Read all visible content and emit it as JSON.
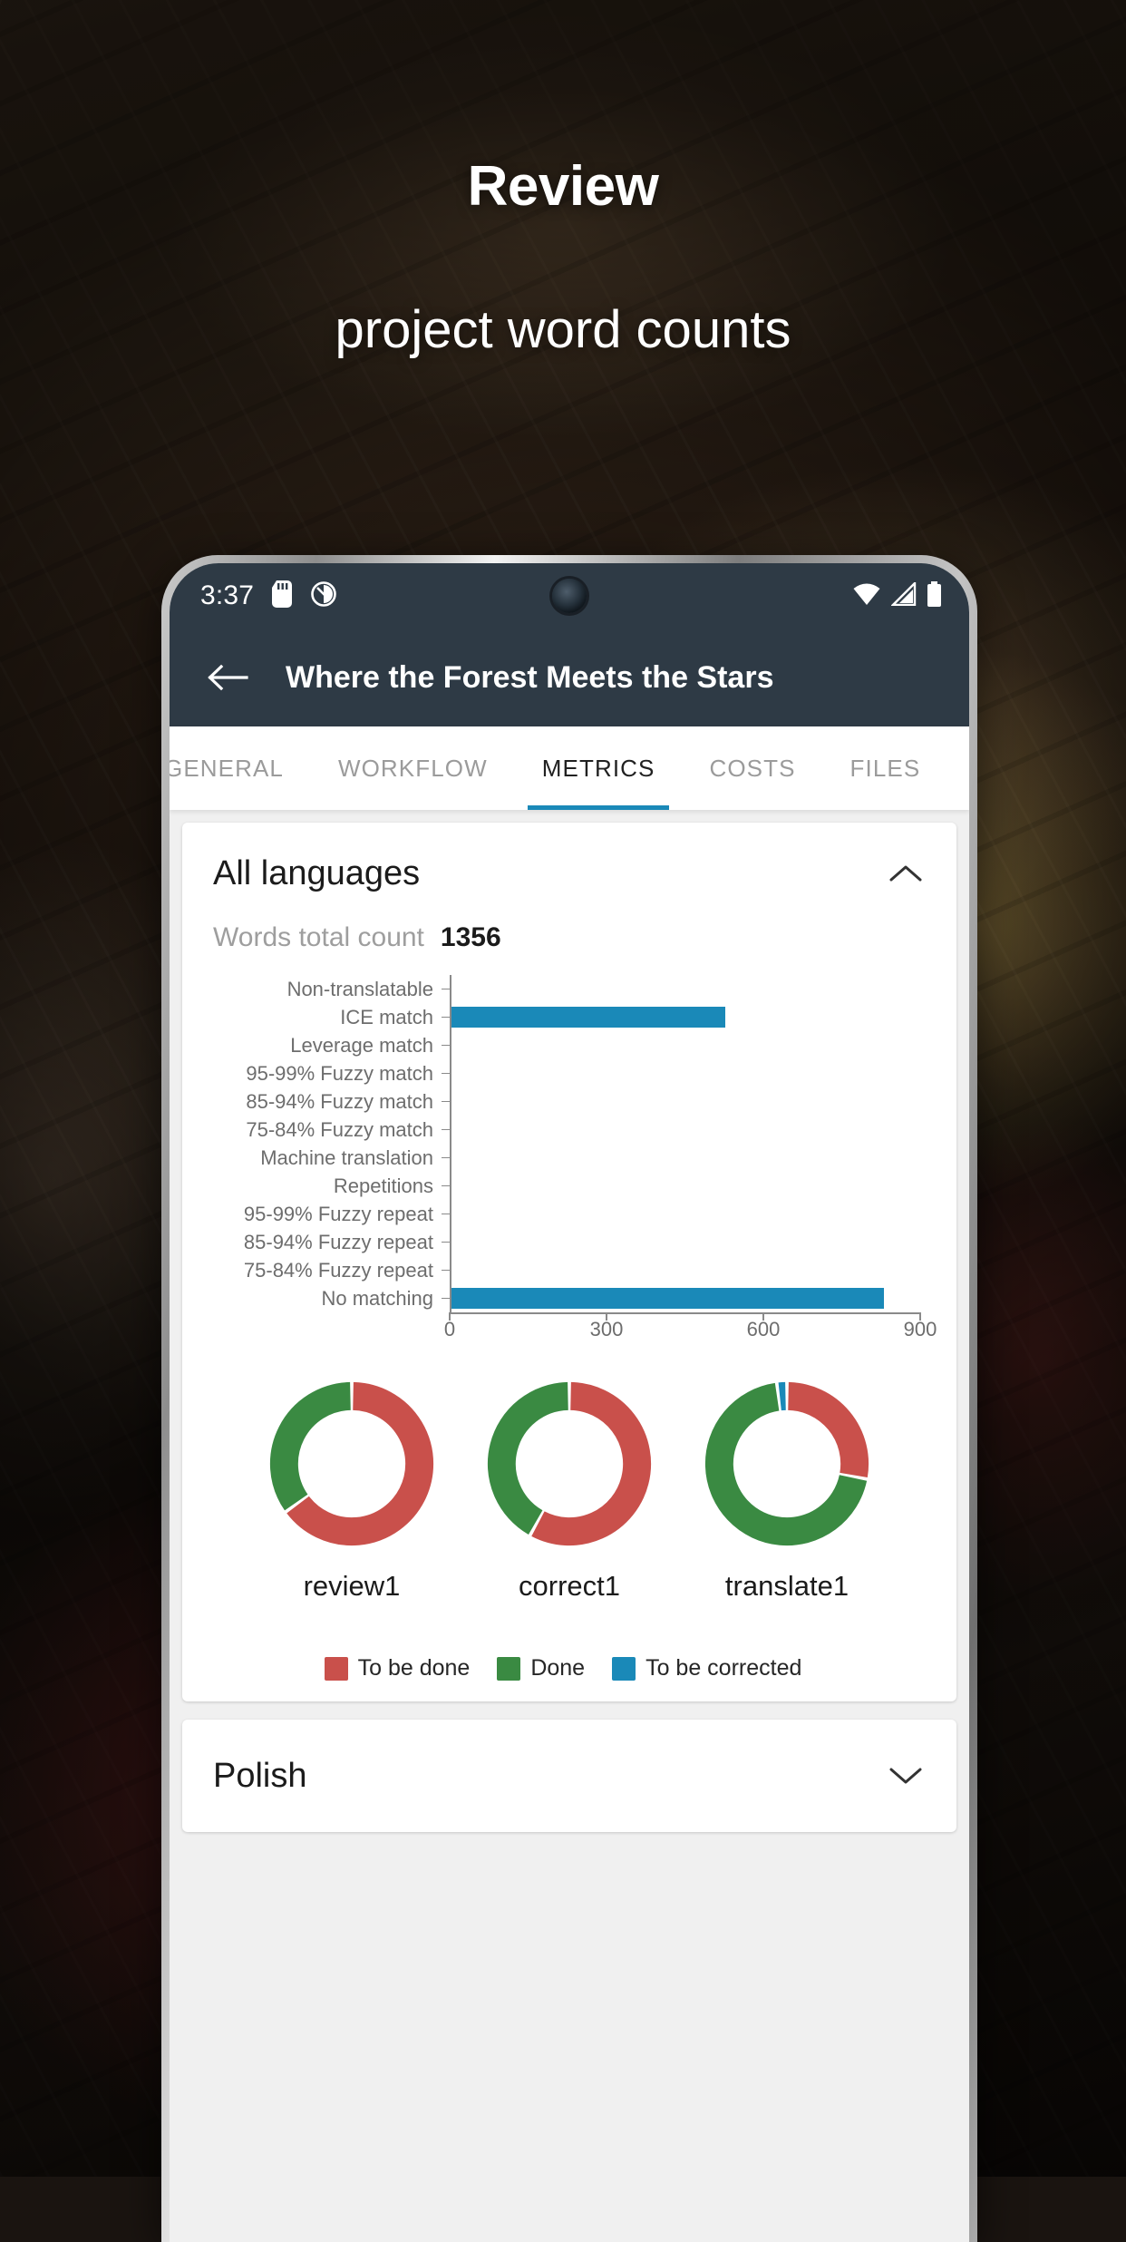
{
  "promo": {
    "title": "Review",
    "subtitle": "project word counts"
  },
  "status_bar": {
    "time": "3:37",
    "icons": [
      "sd-card-icon",
      "do-not-disturb-icon",
      "wifi-icon",
      "cellular-signal-icon",
      "battery-icon"
    ]
  },
  "app_bar": {
    "back_label": "back-arrow-icon",
    "title": "Where the Forest Meets the Stars"
  },
  "tabs": [
    {
      "label": "GENERAL",
      "active": false
    },
    {
      "label": "WORKFLOW",
      "active": false
    },
    {
      "label": "METRICS",
      "active": true
    },
    {
      "label": "COSTS",
      "active": false
    },
    {
      "label": "FILES",
      "active": false
    }
  ],
  "colors": {
    "accent": "#1a89b8",
    "to_be_done": "#c9504b",
    "done": "#3a8a42",
    "to_be_corrected": "#1a89b8",
    "appbar": "#2e3a45"
  },
  "cards": [
    {
      "title": "All languages",
      "expanded": true,
      "chevron": "chevron-up-icon",
      "words_total_label": "Words total count",
      "words_total_value": "1356"
    },
    {
      "title": "Polish",
      "expanded": false,
      "chevron": "chevron-down-icon"
    }
  ],
  "chart_data": [
    {
      "type": "bar",
      "orientation": "horizontal",
      "title": "Words total count",
      "xlabel": "",
      "ylabel": "",
      "xlim": [
        0,
        900
      ],
      "xticks": [
        0,
        300,
        600,
        900
      ],
      "grid": false,
      "bar_color": "#1a89b8",
      "categories": [
        "Non-translatable",
        "ICE match",
        "Leverage match",
        "95-99% Fuzzy match",
        "85-94% Fuzzy match",
        "75-84% Fuzzy match",
        "Machine translation",
        "Repetitions",
        "95-99% Fuzzy repeat",
        "85-94% Fuzzy repeat",
        "75-84% Fuzzy repeat",
        "No matching"
      ],
      "values": [
        0,
        526,
        0,
        0,
        0,
        0,
        0,
        0,
        0,
        0,
        0,
        830
      ]
    },
    {
      "type": "pie",
      "subtype": "donut",
      "title": "review1",
      "labels": [
        "To be done",
        "Done",
        "To be corrected"
      ],
      "values": [
        65,
        35,
        0
      ],
      "colors": [
        "#c9504b",
        "#3a8a42",
        "#1a89b8"
      ]
    },
    {
      "type": "pie",
      "subtype": "donut",
      "title": "correct1",
      "labels": [
        "To be done",
        "Done",
        "To be corrected"
      ],
      "values": [
        58,
        42,
        0
      ],
      "colors": [
        "#c9504b",
        "#3a8a42",
        "#1a89b8"
      ]
    },
    {
      "type": "pie",
      "subtype": "donut",
      "title": "translate1",
      "labels": [
        "To be done",
        "Done",
        "To be corrected"
      ],
      "values": [
        28,
        70,
        2
      ],
      "colors": [
        "#c9504b",
        "#3a8a42",
        "#1a89b8"
      ]
    }
  ],
  "donut_labels": [
    "review1",
    "correct1",
    "translate1"
  ],
  "legend": [
    {
      "label": "To be done",
      "color": "#c9504b"
    },
    {
      "label": "Done",
      "color": "#3a8a42"
    },
    {
      "label": "To be corrected",
      "color": "#1a89b8"
    }
  ],
  "axis_labels": [
    "0",
    "300",
    "600",
    "900"
  ]
}
